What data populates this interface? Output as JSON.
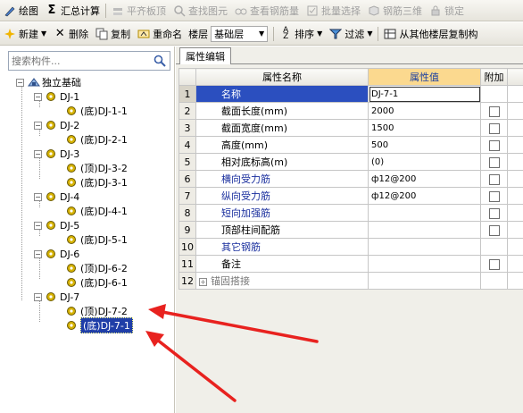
{
  "toolbar1": {
    "draw": "绘图",
    "sum": "汇总计算",
    "level_top": "平齐板顶",
    "find_element": "查找图元",
    "view_rebar_qty": "查看钢筋量",
    "batch_select": "批量选择",
    "rebar_3d": "钢筋三维",
    "lock": "锁定"
  },
  "toolbar2": {
    "new": "新建",
    "delete": "删除",
    "copy": "复制",
    "rename": "重命名",
    "floor_label": "楼层",
    "floor_value": "基础层",
    "sort": "排序",
    "filter": "过滤",
    "copy_from_other": "从其他楼层复制构"
  },
  "search": {
    "placeholder": "搜索构件..."
  },
  "tree": {
    "root": "独立基础",
    "items": [
      {
        "label": "DJ-1"
      },
      {
        "label": "(底)DJ-1-1"
      },
      {
        "label": "DJ-2"
      },
      {
        "label": "(底)DJ-2-1"
      },
      {
        "label": "DJ-3"
      },
      {
        "label": "(顶)DJ-3-2"
      },
      {
        "label": "(底)DJ-3-1"
      },
      {
        "label": "DJ-4"
      },
      {
        "label": "(底)DJ-4-1"
      },
      {
        "label": "DJ-5"
      },
      {
        "label": "(底)DJ-5-1"
      },
      {
        "label": "DJ-6"
      },
      {
        "label": "(顶)DJ-6-2"
      },
      {
        "label": "(底)DJ-6-1"
      },
      {
        "label": "DJ-7"
      },
      {
        "label": "(顶)DJ-7-2"
      },
      {
        "label": "(底)DJ-7-1"
      }
    ]
  },
  "props": {
    "tab": "属性编辑",
    "col_name": "属性名称",
    "col_value": "属性值",
    "col_extra": "附加",
    "rows": [
      {
        "no": "1",
        "name": "名称",
        "value": "DJ-7-1"
      },
      {
        "no": "2",
        "name": "截面长度(mm)",
        "value": "2000"
      },
      {
        "no": "3",
        "name": "截面宽度(mm)",
        "value": "1500"
      },
      {
        "no": "4",
        "name": "高度(mm)",
        "value": "500"
      },
      {
        "no": "5",
        "name": "相对底标高(m)",
        "value": "(0)"
      },
      {
        "no": "6",
        "name": "横向受力筋",
        "value": "ф12@200"
      },
      {
        "no": "7",
        "name": "纵向受力筋",
        "value": "ф12@200"
      },
      {
        "no": "8",
        "name": "短向加强筋",
        "value": ""
      },
      {
        "no": "9",
        "name": "顶部柱间配筋",
        "value": ""
      },
      {
        "no": "10",
        "name": "其它钢筋",
        "value": ""
      },
      {
        "no": "11",
        "name": "备注",
        "value": ""
      },
      {
        "no": "12",
        "name": "锚固搭接",
        "value": ""
      }
    ]
  },
  "colors": {
    "selection": "#1f3ea8",
    "header_value": "#fbd98f",
    "arrow": "#e8221f"
  }
}
